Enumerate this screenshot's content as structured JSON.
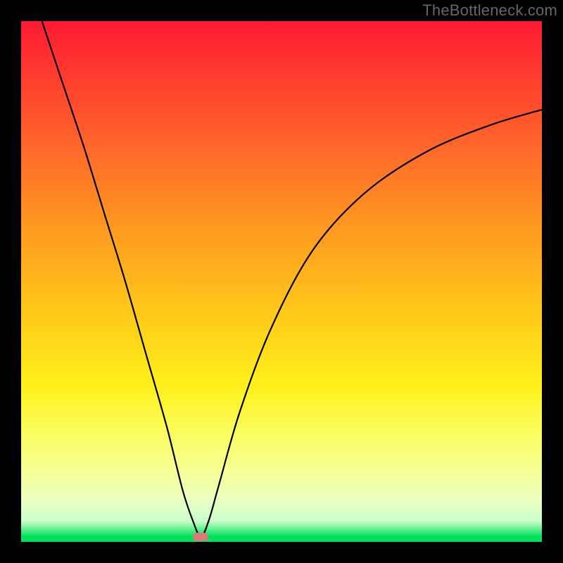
{
  "watermark": "TheBottleneck.com",
  "chart_data": {
    "type": "line",
    "title": "",
    "xlabel": "",
    "ylabel": "",
    "xlim": [
      0,
      100
    ],
    "ylim": [
      0,
      100
    ],
    "grid": false,
    "legend": false,
    "gradient_stops": [
      {
        "pos": 0,
        "color": "#ff1a33"
      },
      {
        "pos": 55,
        "color": "#ffc61a"
      },
      {
        "pos": 80,
        "color": "#faff66"
      },
      {
        "pos": 100,
        "color": "#00e05a"
      }
    ],
    "series": [
      {
        "name": "bottleneck-curve",
        "x": [
          4,
          8,
          12,
          16,
          20,
          24,
          28,
          31,
          33,
          34.5,
          36,
          38,
          42,
          48,
          56,
          66,
          78,
          90,
          100
        ],
        "values": [
          100,
          88,
          76,
          63,
          50,
          36,
          22,
          10,
          4,
          1,
          4,
          11,
          25,
          41,
          56,
          67,
          75,
          80,
          83
        ]
      }
    ],
    "marker": {
      "x": 34.5,
      "y": 1,
      "color": "#da7a7a"
    }
  }
}
